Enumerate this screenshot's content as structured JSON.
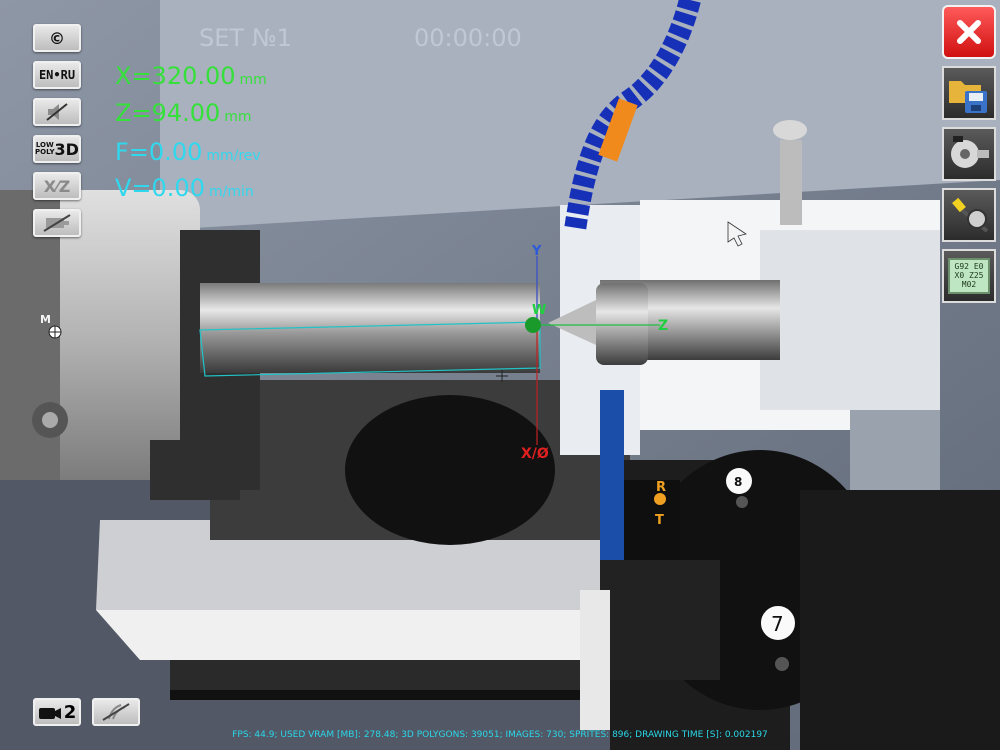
{
  "hud": {
    "set_title": "SET №1",
    "timer": "00:00:00",
    "x_value": "X=320.00",
    "x_unit": "mm",
    "z_value": "Z=94.00",
    "z_unit": "mm",
    "f_value": "F=0.00",
    "f_unit": "mm/rev",
    "v_value": "V=0.00",
    "v_unit": "m/min"
  },
  "left_toolbar": {
    "copyright": "©",
    "language": "EN•RU",
    "lowpoly_top1": "LOW",
    "lowpoly_top2": "POLY",
    "lowpoly_3d": "3D",
    "xz": "X⁄Z"
  },
  "scene_labels": {
    "axis_y": "Y",
    "axis_z": "Z",
    "axis_x": "X/Ø",
    "point_w": "W",
    "point_m": "M",
    "point_r": "R",
    "point_t": "T",
    "turret_8": "8",
    "turret_7": "7"
  },
  "right_toolbar": {
    "cnc_code": [
      "G92 E0",
      "X0 Z25",
      "M02"
    ]
  },
  "camera": {
    "label": "2"
  },
  "status_bar": "FPS: 44.9; USED VRAM [MB]: 278.48; 3D POLYGONS: 39051; IMAGES: 730; SPRITES: 896; DRAWING TIME [S]: 0.002197",
  "colors": {
    "hud_green": "#35e03a",
    "hud_cyan": "#30d8ee",
    "close_red": "#e02020",
    "status_cyan": "#2ad7e8"
  }
}
